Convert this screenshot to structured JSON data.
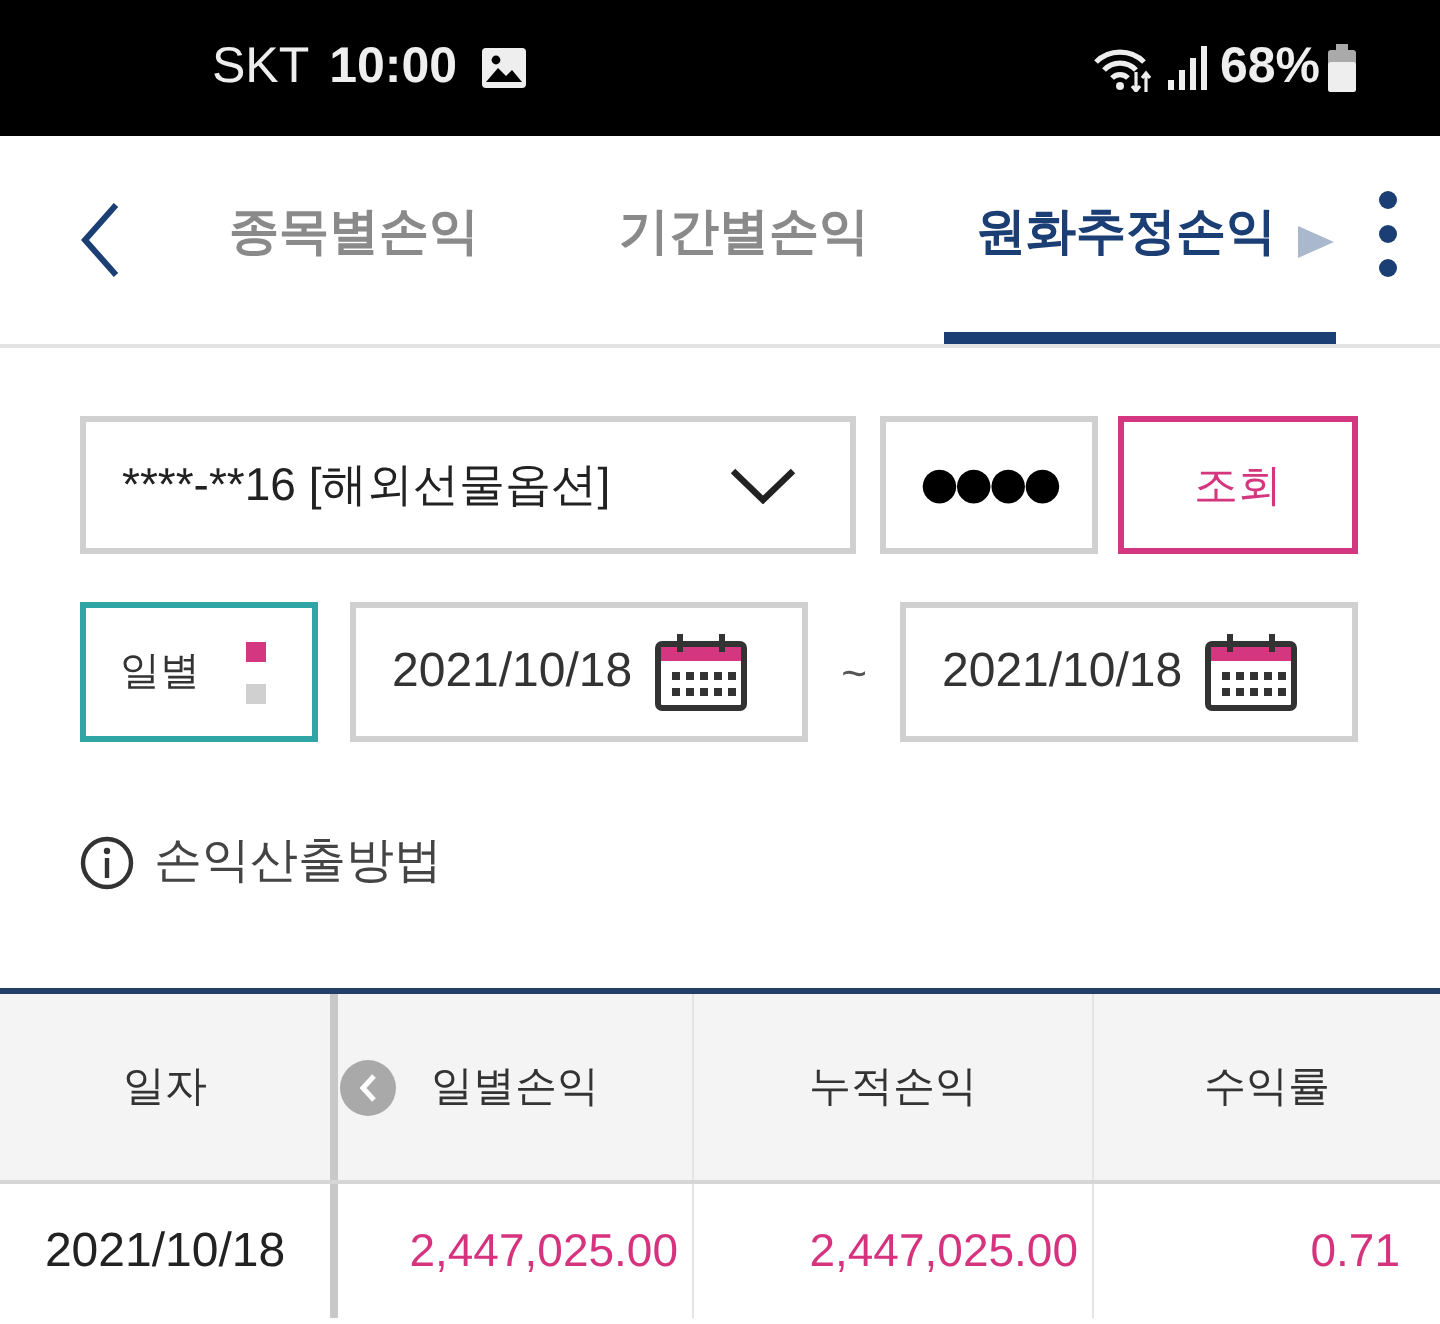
{
  "status_bar": {
    "carrier": "SKT",
    "time": "10:00",
    "battery": "68%"
  },
  "nav": {
    "tabs": [
      {
        "label": "종목별손익",
        "selected": false
      },
      {
        "label": "기간별손익",
        "selected": false
      },
      {
        "label": "원화추정손익",
        "selected": true
      }
    ]
  },
  "query_form": {
    "account": {
      "value": "****-**16 [해외선물옵션]"
    },
    "password": {
      "value": "●●●●"
    },
    "search_button": "조회",
    "period": {
      "label": "일별",
      "options": [
        {
          "selected": true
        },
        {
          "selected": false
        }
      ]
    },
    "date_from": {
      "value": "2021/10/18"
    },
    "separator": "~",
    "date_to": {
      "value": "2021/10/18"
    }
  },
  "info_link": "손익산출방법",
  "table": {
    "columns": [
      "일자",
      "일별손익",
      "누적손익",
      "수익률"
    ],
    "rows": [
      [
        "2021/10/18",
        "2,447,025.00",
        "2,447,025.00",
        "0.71"
      ]
    ]
  }
}
